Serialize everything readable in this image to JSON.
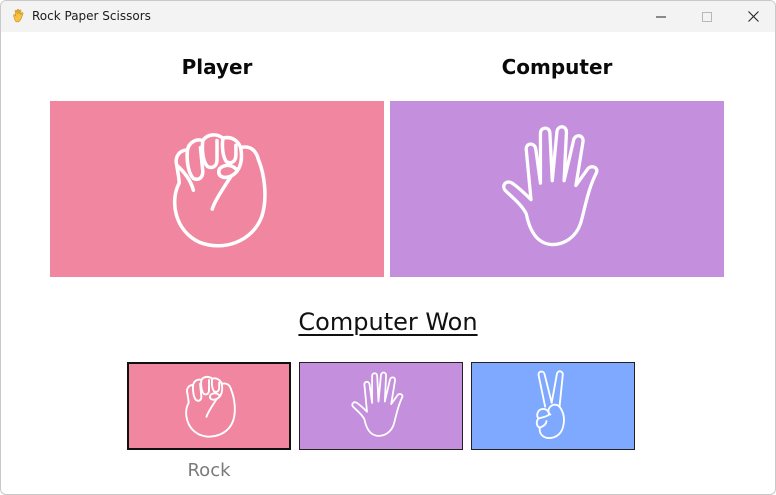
{
  "window": {
    "title": "Rock Paper Scissors",
    "app_icon": "waving-hand-icon",
    "controls": [
      "minimize-icon",
      "maximize-icon",
      "close-icon"
    ]
  },
  "headings": {
    "player": "Player",
    "computer": "Computer"
  },
  "player_panel": {
    "icon": "rock-fist-icon",
    "color": "#f0869f"
  },
  "computer_panel": {
    "icon": "paper-hand-icon",
    "color": "#c48fdc"
  },
  "result_text": "Computer Won",
  "choices": [
    {
      "icon": "rock-fist-icon",
      "color": "#f0869f",
      "selected": true
    },
    {
      "icon": "paper-hand-icon",
      "color": "#c48fdc",
      "selected": false
    },
    {
      "icon": "scissors-hand-icon",
      "color": "#7fa9ff",
      "selected": false
    }
  ],
  "hover_label": "Rock"
}
